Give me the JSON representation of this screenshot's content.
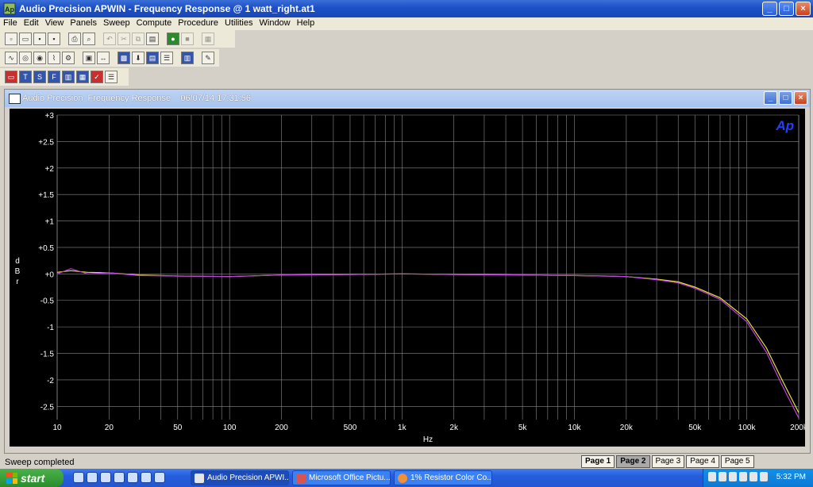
{
  "window": {
    "title": "Audio Precision APWIN - Frequency Response @ 1 watt_right.at1",
    "buttons": {
      "minimize": "_",
      "maximize": "□",
      "close": "×"
    }
  },
  "menu": [
    "File",
    "Edit",
    "View",
    "Panels",
    "Sweep",
    "Compute",
    "Procedure",
    "Utilities",
    "Window",
    "Help"
  ],
  "graph_window": {
    "title": "Audio Precision  Frequency Response    06/07/14 17:31:56",
    "logo": "Ap"
  },
  "chart_data": {
    "type": "line",
    "xlabel": "Hz",
    "ylabel": "dBr",
    "x_scale": "log",
    "xlim": [
      10,
      200000
    ],
    "ylim": [
      -2.75,
      3
    ],
    "x_ticks": [
      {
        "v": 10,
        "label": "10"
      },
      {
        "v": 20,
        "label": "20"
      },
      {
        "v": 50,
        "label": "50"
      },
      {
        "v": 100,
        "label": "100"
      },
      {
        "v": 200,
        "label": "200"
      },
      {
        "v": 500,
        "label": "500"
      },
      {
        "v": 1000,
        "label": "1k"
      },
      {
        "v": 2000,
        "label": "2k"
      },
      {
        "v": 5000,
        "label": "5k"
      },
      {
        "v": 10000,
        "label": "10k"
      },
      {
        "v": 20000,
        "label": "20k"
      },
      {
        "v": 50000,
        "label": "50k"
      },
      {
        "v": 100000,
        "label": "100k"
      },
      {
        "v": 200000,
        "label": "200k"
      }
    ],
    "y_ticks": [
      {
        "v": 3,
        "label": "+3"
      },
      {
        "v": 2.5,
        "label": "+2.5"
      },
      {
        "v": 2,
        "label": "+2"
      },
      {
        "v": 1.5,
        "label": "+1.5"
      },
      {
        "v": 1,
        "label": "+1"
      },
      {
        "v": 0.5,
        "label": "+0.5"
      },
      {
        "v": 0,
        "label": "+0"
      },
      {
        "v": -0.5,
        "label": "-0.5"
      },
      {
        "v": -1,
        "label": "-1"
      },
      {
        "v": -1.5,
        "label": "-1.5"
      },
      {
        "v": -2,
        "label": "-2"
      },
      {
        "v": -2.5,
        "label": "-2.5"
      }
    ],
    "grid": true,
    "background": "#000000",
    "grid_color": "#8a8a8a",
    "series": [
      {
        "color": "#e8e03a",
        "points": [
          [
            10,
            0.03
          ],
          [
            12,
            0.06
          ],
          [
            15,
            0.03
          ],
          [
            20,
            0.02
          ],
          [
            30,
            -0.02
          ],
          [
            50,
            -0.04
          ],
          [
            100,
            -0.05
          ],
          [
            200,
            -0.02
          ],
          [
            500,
            -0.01
          ],
          [
            1000,
            0.0
          ],
          [
            2000,
            -0.01
          ],
          [
            5000,
            -0.02
          ],
          [
            10000,
            -0.03
          ],
          [
            15000,
            -0.04
          ],
          [
            20000,
            -0.05
          ],
          [
            30000,
            -0.1
          ],
          [
            40000,
            -0.15
          ],
          [
            50000,
            -0.25
          ],
          [
            70000,
            -0.45
          ],
          [
            100000,
            -0.85
          ],
          [
            130000,
            -1.4
          ],
          [
            160000,
            -2.0
          ],
          [
            200000,
            -2.62
          ]
        ]
      },
      {
        "color": "#c040e0",
        "points": [
          [
            10,
            0.0
          ],
          [
            12,
            0.1
          ],
          [
            15,
            0.0
          ],
          [
            20,
            0.02
          ],
          [
            30,
            -0.03
          ],
          [
            50,
            -0.04
          ],
          [
            100,
            -0.05
          ],
          [
            200,
            -0.02
          ],
          [
            500,
            -0.01
          ],
          [
            1000,
            0.0
          ],
          [
            2000,
            -0.01
          ],
          [
            5000,
            -0.02
          ],
          [
            10000,
            -0.03
          ],
          [
            15000,
            -0.04
          ],
          [
            20000,
            -0.05
          ],
          [
            30000,
            -0.11
          ],
          [
            40000,
            -0.17
          ],
          [
            50000,
            -0.27
          ],
          [
            70000,
            -0.48
          ],
          [
            100000,
            -0.9
          ],
          [
            130000,
            -1.48
          ],
          [
            160000,
            -2.1
          ],
          [
            200000,
            -2.72
          ]
        ]
      }
    ]
  },
  "status": {
    "text": "Sweep completed"
  },
  "pages": [
    "Page 1",
    "Page 2",
    "Page 3",
    "Page 4",
    "Page 5"
  ],
  "taskbar": {
    "start": "start",
    "tasks": [
      "Audio Precision APWI...",
      "Microsoft Office Pictu...",
      "1% Resistor Color Co..."
    ],
    "clock": "5:32 PM"
  }
}
